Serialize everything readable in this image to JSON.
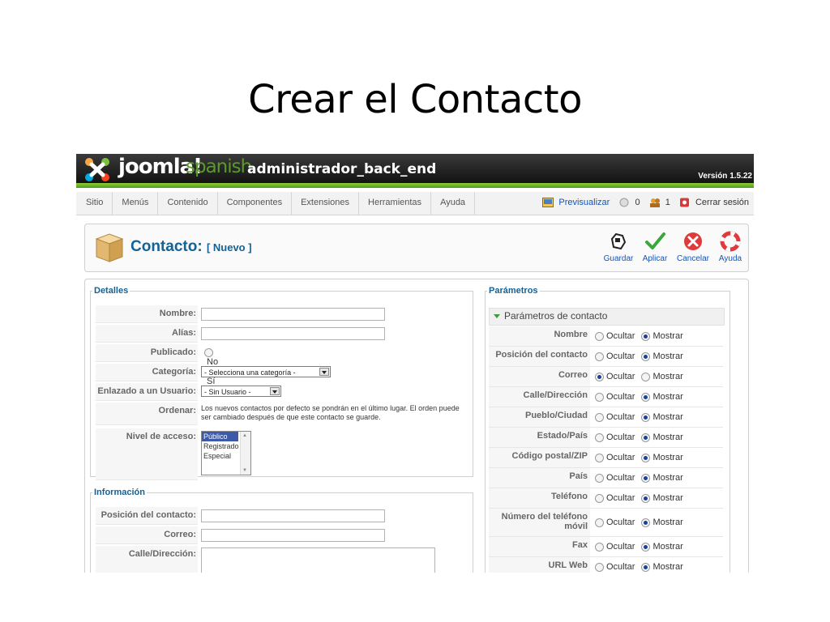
{
  "slide": {
    "title": "Crear el Contacto"
  },
  "header": {
    "logo": "joomla!",
    "logo_lang": "spanish",
    "title": "administrador_back_end",
    "version": "Versión 1.5.22"
  },
  "menu": [
    "Sitio",
    "Menús",
    "Contenido",
    "Componentes",
    "Extensiones",
    "Herramientas",
    "Ayuda"
  ],
  "status": {
    "preview": "Previsualizar",
    "messages": "0",
    "users": "1",
    "logout": "Cerrar sesión"
  },
  "toolbar": {
    "title": "Contacto:",
    "subtitle": "[ Nuevo ]",
    "save": "Guardar",
    "apply": "Aplicar",
    "cancel": "Cancelar",
    "help": "Ayuda"
  },
  "details": {
    "legend": "Detalles",
    "name_label": "Nombre:",
    "alias_label": "Alías:",
    "published_label": "Publicado:",
    "published_no": "No",
    "published_yes": "Sí",
    "category_label": "Categoría:",
    "category_value": "- Selecciona una categoría -",
    "user_label": "Enlazado a un Usuario:",
    "user_value": "- Sin Usuario -",
    "order_label": "Ordenar:",
    "order_text": "Los nuevos contactos por defecto se pondrán en el último lugar. El orden puede ser cambiado después de que este contacto se guarde.",
    "access_label": "Nivel de acceso:",
    "access_options": [
      "Público",
      "Registrado",
      "Especial"
    ]
  },
  "info": {
    "legend": "Información",
    "position_label": "Posición del contacto:",
    "email_label": "Correo:",
    "street_label": "Calle/Dirección:"
  },
  "params": {
    "legend": "Parámetros",
    "section": "Parámetros de contacto",
    "hide": "Ocultar",
    "show": "Mostrar",
    "rows": [
      {
        "label": "Nombre",
        "selected": "show"
      },
      {
        "label": "Posición del contacto",
        "selected": "show"
      },
      {
        "label": "Correo",
        "selected": "hide"
      },
      {
        "label": "Calle/Dirección",
        "selected": "show"
      },
      {
        "label": "Pueblo/Ciudad",
        "selected": "show"
      },
      {
        "label": "Estado/País",
        "selected": "show"
      },
      {
        "label": "Código postal/ZIP",
        "selected": "show"
      },
      {
        "label": "País",
        "selected": "show"
      },
      {
        "label": "Teléfono",
        "selected": "show"
      },
      {
        "label": "Número del teléfono móvil",
        "selected": "show"
      },
      {
        "label": "Fax",
        "selected": "show"
      },
      {
        "label": "URL Web",
        "selected": "show"
      }
    ]
  },
  "colors": {
    "header_accent": "#6bb324",
    "title_blue": "#146295",
    "link_blue": "#0b55c4"
  }
}
